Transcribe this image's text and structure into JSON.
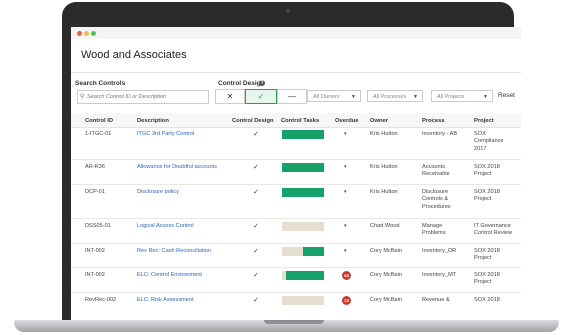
{
  "window": {
    "dots": [
      "#ec5a52",
      "#f2bd4a",
      "#53c25c"
    ]
  },
  "app": {
    "title": "Wood and Associates"
  },
  "filters": {
    "search_label": "Search Controls",
    "search_placeholder": "Search Control ID or Description",
    "design_label": "Control Design",
    "design_options": [
      "✕",
      "✓",
      "—"
    ],
    "owners_placeholder": "All Owners",
    "processes_placeholder": "All Processes",
    "projects_placeholder": "All Projects",
    "reset_label": "Reset"
  },
  "table": {
    "headers": [
      "Control ID",
      "Description",
      "Control Design",
      "Control Tasks",
      "Overdue",
      "Owner",
      "Process",
      "Project"
    ],
    "rows": [
      {
        "id": "1-ITGC-01",
        "desc": "ITGC 3rd Party Control",
        "design": "✓",
        "tasks_done": 1.0,
        "overdue": "",
        "owner": "Kris Hutton",
        "process": "Inventory - AB",
        "project": "SOX\nCompliance\n2017"
      },
      {
        "id": "AR-R36",
        "desc": "Allowance for Doubtful accounts",
        "design": "✓",
        "tasks_done": 1.0,
        "overdue": "",
        "owner": "Kris Hutton",
        "process": "Accounts\nReceivable",
        "project": "SOX 2018\nProject"
      },
      {
        "id": "DCP-01",
        "desc": "Disclosure policy",
        "design": "✓",
        "tasks_done": 1.0,
        "overdue": "",
        "owner": "Kris Hutton",
        "process": "Disclosure\nControls &\nProcedures",
        "project": "SOX 2018\nProject"
      },
      {
        "id": "DSS05-01",
        "desc": "Logical Access Control",
        "design": "✓",
        "tasks_done": 0.0,
        "overdue": "",
        "owner": "Chad Wood",
        "process": "Manage\nProblems",
        "project": "IT Governance\nControl Review"
      },
      {
        "id": "INT-002",
        "desc": "Rev Rec: Cash Reconciliation",
        "design": "✓",
        "tasks_done": 0.5,
        "overdue": "",
        "owner": "Cory McBain",
        "process": "Inventory_DR",
        "project": "SOX 2018\nProject"
      },
      {
        "id": "INT-002",
        "desc": "ELC: Control Environment",
        "design": "✓",
        "tasks_done": 0.9,
        "overdue": "44",
        "owner": "Cory McBain",
        "process": "Inventory_MT",
        "project": "SOX 2018\nProject"
      },
      {
        "id": "RevRec-002",
        "desc": "ELC: Risk Assessment",
        "design": "✓",
        "tasks_done": 0.0,
        "overdue": "13",
        "owner": "Cory McBain",
        "process": "Revenue &",
        "project": "SOX 2018"
      }
    ]
  },
  "colors": {
    "accent": "#17a16a",
    "link": "#2a66b8",
    "badge": "#c8372d",
    "bar_empty": "#e6ddd3"
  }
}
